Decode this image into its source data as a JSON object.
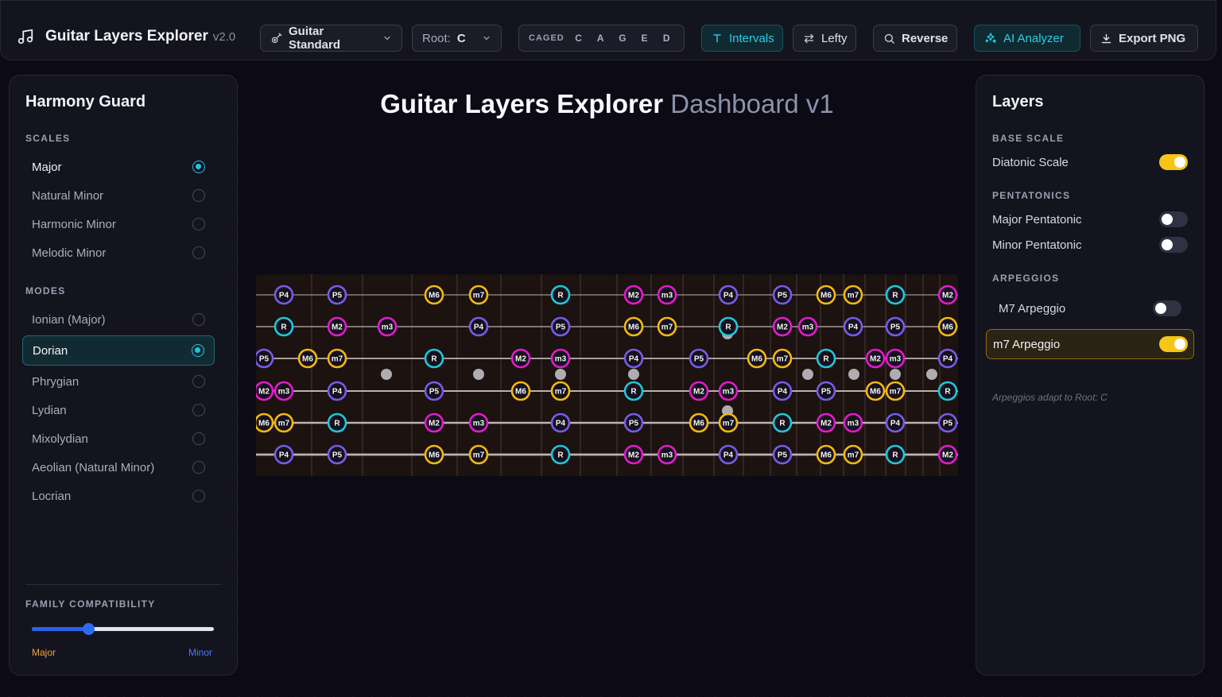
{
  "app": {
    "title": "Guitar Layers Explorer",
    "version": "v2.0"
  },
  "toolbar": {
    "tuning": "Guitar Standard",
    "root_label": "Root:",
    "root_value": "C",
    "caged_label": "CAGED",
    "caged_letters": [
      "C",
      "A",
      "G",
      "E",
      "D"
    ],
    "intervals_label": "Intervals",
    "lefty_label": "Lefty",
    "reverse_label": "Reverse",
    "ai_label": "AI Analyzer",
    "export_label": "Export PNG"
  },
  "main": {
    "title": "Guitar Layers Explorer",
    "subtitle": "Dashboard v1"
  },
  "harmony": {
    "title": "Harmony Guard",
    "scales_label": "SCALES",
    "scales": [
      {
        "label": "Major",
        "selected": true
      },
      {
        "label": "Natural Minor",
        "selected": false
      },
      {
        "label": "Harmonic Minor",
        "selected": false
      },
      {
        "label": "Melodic Minor",
        "selected": false
      }
    ],
    "modes_label": "MODES",
    "modes": [
      {
        "label": "Ionian (Major)",
        "selected": false
      },
      {
        "label": "Dorian",
        "selected": true
      },
      {
        "label": "Phrygian",
        "selected": false
      },
      {
        "label": "Lydian",
        "selected": false
      },
      {
        "label": "Mixolydian",
        "selected": false
      },
      {
        "label": "Aeolian (Natural Minor)",
        "selected": false
      },
      {
        "label": "Locrian",
        "selected": false
      }
    ],
    "family_label": "FAMILY COMPATIBILITY",
    "family_value": 0.31,
    "family_left": "Major",
    "family_right": "Minor"
  },
  "layers": {
    "title": "Layers",
    "base_label": "BASE SCALE",
    "diatonic": {
      "label": "Diatonic Scale",
      "on": true
    },
    "pent_label": "PENTATONICS",
    "major_pent": {
      "label": "Major Pentatonic",
      "on": false
    },
    "minor_pent": {
      "label": "Minor Pentatonic",
      "on": false
    },
    "arp_label": "ARPEGGIOS",
    "m7_major": {
      "label": "M7 Arpeggio",
      "on": false
    },
    "m7_minor": {
      "label": "m7 Arpeggio",
      "on": true
    },
    "note": "Arpeggios adapt to Root: C"
  },
  "colors": {
    "R": "#1ec8dc",
    "M2": "#e11ccd",
    "m3": "#e11ccd",
    "P4": "#7a5ae6",
    "P5": "#7a5ae6",
    "M6": "#f3b90f",
    "m7": "#f3b90f",
    "accent": "#22c3dc",
    "toggle_on": "#f5c518"
  },
  "fretboard": {
    "strings": [
      {
        "notes": [
          [
            1,
            "P4"
          ],
          [
            3,
            "P5"
          ],
          [
            5,
            "M6"
          ],
          [
            6,
            "m7"
          ],
          [
            8,
            "R"
          ],
          [
            10,
            "M2"
          ],
          [
            11,
            "m3"
          ],
          [
            13,
            "P4"
          ],
          [
            15,
            "P5"
          ],
          [
            17,
            "M6"
          ],
          [
            18,
            "m7"
          ],
          [
            20,
            "R"
          ],
          [
            22,
            "M2"
          ]
        ]
      },
      {
        "notes": [
          [
            1,
            "R"
          ],
          [
            3,
            "M2"
          ],
          [
            4,
            "m3"
          ],
          [
            6,
            "P4"
          ],
          [
            8,
            "P5"
          ],
          [
            10,
            "M6"
          ],
          [
            11,
            "m7"
          ],
          [
            13,
            "R"
          ],
          [
            15,
            "M2"
          ],
          [
            16,
            "m3"
          ],
          [
            18,
            "P4"
          ],
          [
            20,
            "P5"
          ],
          [
            22,
            "M6"
          ]
        ]
      },
      {
        "notes": [
          [
            0,
            "P5"
          ],
          [
            2,
            "M6"
          ],
          [
            3,
            "m7"
          ],
          [
            5,
            "R"
          ],
          [
            7,
            "M2"
          ],
          [
            8,
            "m3"
          ],
          [
            10,
            "P4"
          ],
          [
            12,
            "P5"
          ],
          [
            14,
            "M6"
          ],
          [
            15,
            "m7"
          ],
          [
            17,
            "R"
          ],
          [
            19,
            "M2"
          ],
          [
            20,
            "m3"
          ],
          [
            22,
            "P4"
          ]
        ]
      },
      {
        "notes": [
          [
            0,
            "M2"
          ],
          [
            1,
            "m3"
          ],
          [
            3,
            "P4"
          ],
          [
            5,
            "P5"
          ],
          [
            7,
            "M6"
          ],
          [
            8,
            "m7"
          ],
          [
            10,
            "R"
          ],
          [
            12,
            "M2"
          ],
          [
            13,
            "m3"
          ],
          [
            15,
            "P4"
          ],
          [
            17,
            "P5"
          ],
          [
            19,
            "M6"
          ],
          [
            20,
            "m7"
          ],
          [
            22,
            "R"
          ]
        ]
      },
      {
        "notes": [
          [
            0,
            "M6"
          ],
          [
            1,
            "m7"
          ],
          [
            3,
            "R"
          ],
          [
            5,
            "M2"
          ],
          [
            6,
            "m3"
          ],
          [
            8,
            "P4"
          ],
          [
            10,
            "P5"
          ],
          [
            12,
            "M6"
          ],
          [
            13,
            "m7"
          ],
          [
            15,
            "R"
          ],
          [
            17,
            "M2"
          ],
          [
            18,
            "m3"
          ],
          [
            20,
            "P4"
          ],
          [
            22,
            "P5"
          ]
        ]
      },
      {
        "notes": [
          [
            1,
            "P4"
          ],
          [
            3,
            "P5"
          ],
          [
            5,
            "M6"
          ],
          [
            6,
            "m7"
          ],
          [
            8,
            "R"
          ],
          [
            10,
            "M2"
          ],
          [
            11,
            "m3"
          ],
          [
            13,
            "P4"
          ],
          [
            15,
            "P5"
          ],
          [
            17,
            "M6"
          ],
          [
            18,
            "m7"
          ],
          [
            20,
            "R"
          ],
          [
            22,
            "M2"
          ]
        ]
      }
    ]
  }
}
